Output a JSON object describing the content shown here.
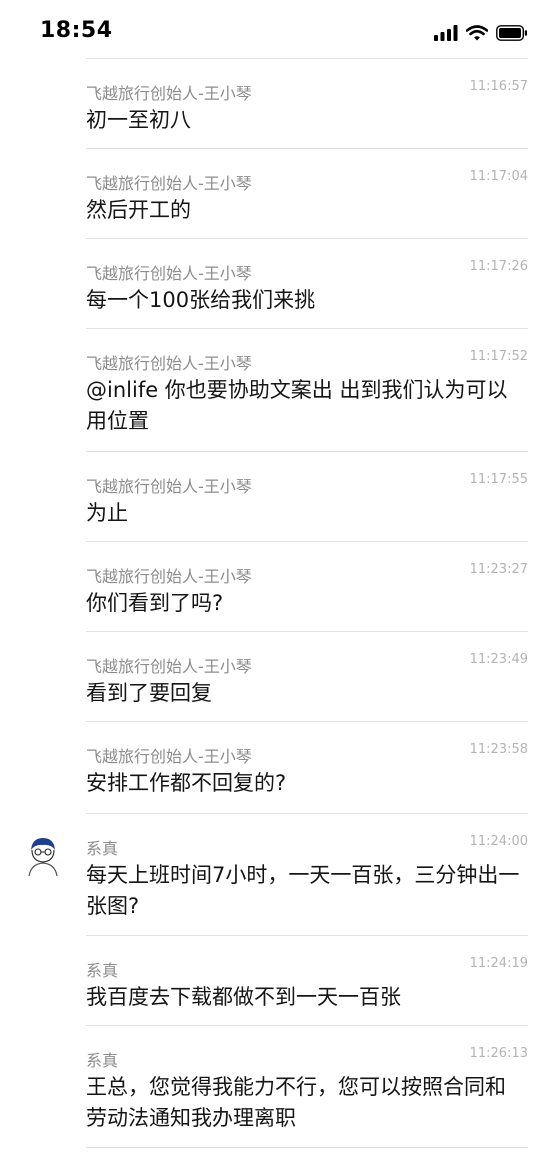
{
  "status_bar": {
    "time": "18:54",
    "icons": [
      "cellular-signal-icon",
      "wifi-icon",
      "battery-icon"
    ]
  },
  "messages": [
    {
      "sender": "飞越旅行创始人-王小琴",
      "time": "11:16:57",
      "text": "初一至初八",
      "avatar": false
    },
    {
      "sender": "飞越旅行创始人-王小琴",
      "time": "11:17:04",
      "text": "然后开工的",
      "avatar": false
    },
    {
      "sender": "飞越旅行创始人-王小琴",
      "time": "11:17:26",
      "text": "每一个100张给我们来挑",
      "avatar": false
    },
    {
      "sender": "飞越旅行创始人-王小琴",
      "time": "11:17:52",
      "text": "@inlife 你也要协助文案出 出到我们认为可以用位置",
      "avatar": false
    },
    {
      "sender": "飞越旅行创始人-王小琴",
      "time": "11:17:55",
      "text": "为止",
      "avatar": false
    },
    {
      "sender": "飞越旅行创始人-王小琴",
      "time": "11:23:27",
      "text": "你们看到了吗?",
      "avatar": false
    },
    {
      "sender": "飞越旅行创始人-王小琴",
      "time": "11:23:49",
      "text": "看到了要回复",
      "avatar": false
    },
    {
      "sender": "飞越旅行创始人-王小琴",
      "time": "11:23:58",
      "text": "安排工作都不回复的?",
      "avatar": false
    },
    {
      "sender": "系真",
      "time": "11:24:00",
      "text": "每天上班时间7小时，一天一百张，三分钟出一张图?",
      "avatar": true
    },
    {
      "sender": "系真",
      "time": "11:24:19",
      "text": "我百度去下载都做不到一天一百张",
      "avatar": false
    },
    {
      "sender": "系真",
      "time": "11:26:13",
      "text": "王总，您觉得我能力不行，您可以按照合同和劳动法通知我办理离职",
      "avatar": false
    }
  ]
}
